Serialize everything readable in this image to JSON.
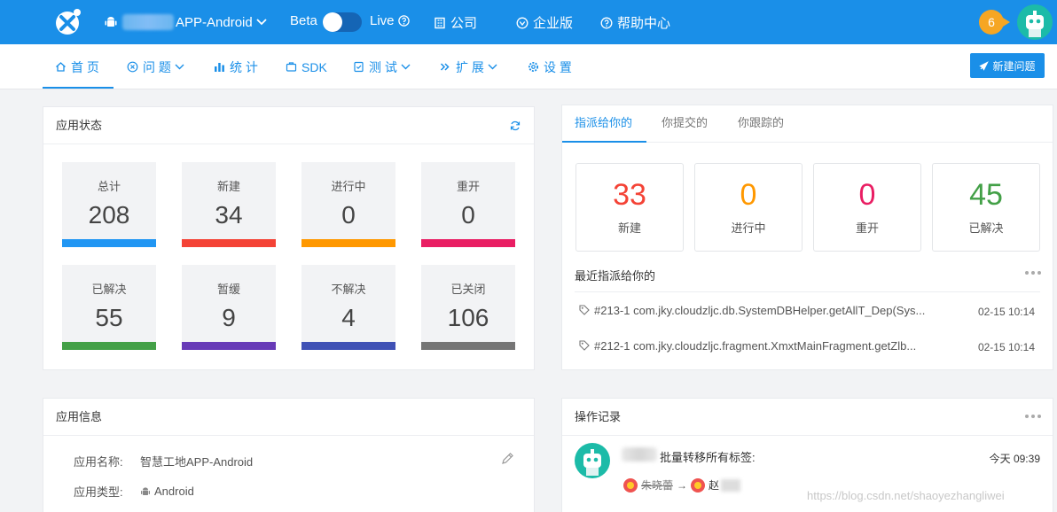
{
  "topbar": {
    "app_name_suffix": "APP-Android",
    "beta_label": "Beta",
    "live_label": "Live",
    "nav": [
      {
        "label": "公司",
        "icon": "building-icon"
      },
      {
        "label": "企业版",
        "icon": "enterprise-icon"
      },
      {
        "label": "帮助中心",
        "icon": "help-icon"
      }
    ],
    "notification_count": "6",
    "colors": {
      "primary": "#1a8fe8",
      "badge": "#f6a623"
    }
  },
  "subnav": {
    "items": [
      {
        "label": "首 页",
        "icon": "home-icon"
      },
      {
        "label": "问 题",
        "icon": "bug-icon"
      },
      {
        "label": "统 计",
        "icon": "stats-icon"
      },
      {
        "label": "SDK",
        "icon": "sdk-icon"
      },
      {
        "label": "测 试",
        "icon": "test-icon"
      },
      {
        "label": "扩 展",
        "icon": "extend-icon"
      },
      {
        "label": "设 置",
        "icon": "settings-icon"
      }
    ],
    "new_issue_label": "新建问题"
  },
  "app_status": {
    "title": "应用状态",
    "tiles": [
      {
        "label": "总计",
        "value": "208",
        "color": "#2196f3"
      },
      {
        "label": "新建",
        "value": "34",
        "color": "#f44336"
      },
      {
        "label": "进行中",
        "value": "0",
        "color": "#ff9800"
      },
      {
        "label": "重开",
        "value": "0",
        "color": "#e91e63"
      },
      {
        "label": "已解决",
        "value": "55",
        "color": "#43a047"
      },
      {
        "label": "暂缓",
        "value": "9",
        "color": "#673ab7"
      },
      {
        "label": "不解决",
        "value": "4",
        "color": "#3f51b5"
      },
      {
        "label": "已关闭",
        "value": "106",
        "color": "#757575"
      }
    ]
  },
  "assigned": {
    "tabs": [
      "指派给你的",
      "你提交的",
      "你跟踪的"
    ],
    "stats": [
      {
        "value": "33",
        "label": "新建",
        "color": "#f44336"
      },
      {
        "value": "0",
        "label": "进行中",
        "color": "#ff9800"
      },
      {
        "value": "0",
        "label": "重开",
        "color": "#e91e63"
      },
      {
        "value": "45",
        "label": "已解决",
        "color": "#43a047"
      }
    ],
    "recent_title": "最近指派给你的",
    "recent": [
      {
        "text": "#213-1 com.jky.cloudzljc.db.SystemDBHelper.getAllT_Dep(Sys...",
        "time": "02-15 10:14"
      },
      {
        "text": "#212-1 com.jky.cloudzljc.fragment.XmxtMainFragment.getZlb...",
        "time": "02-15 10:14"
      }
    ]
  },
  "app_info": {
    "title": "应用信息",
    "rows": [
      {
        "key": "应用名称:",
        "value": "智慧工地APP-Android"
      },
      {
        "key": "应用类型:",
        "value": "Android"
      }
    ]
  },
  "op_log": {
    "title": "操作记录",
    "entry": {
      "action": "批量转移所有标签:",
      "time": "今天 09:39",
      "from_name": "朱晓蕾",
      "to_name": "赵"
    }
  },
  "watermark": "https://blog.csdn.net/shaoyezhangliwei"
}
